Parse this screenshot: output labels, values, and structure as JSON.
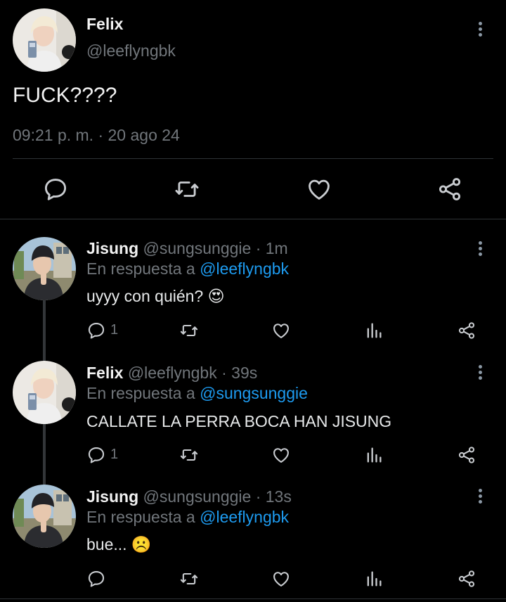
{
  "main_tweet": {
    "name": "Felix",
    "handle": "@leeflyngbk",
    "text": "FUCK????",
    "timestamp": "09:21 p. m. · 20 ago 24"
  },
  "replies": [
    {
      "name": "Jisung",
      "meta": "@sungsunggie · 1m",
      "reply_prefix": "En respuesta a",
      "reply_to": "@leeflyngbk",
      "text": "uyyy con quién? 😍",
      "reply_count": "1"
    },
    {
      "name": "Felix",
      "meta": "@leeflyngbk · 39s",
      "reply_prefix": "En respuesta a",
      "reply_to": "@sungsunggie",
      "text": "CALLATE LA PERRA BOCA HAN JISUNG",
      "reply_count": "1"
    },
    {
      "name": "Jisung",
      "meta": "@sungsunggie · 13s",
      "reply_prefix": "En respuesta a",
      "reply_to": "@leeflyngbk",
      "text": "bue... ☹️",
      "reply_count": ""
    }
  ],
  "colors": {
    "background": "#000000",
    "link": "#1d9bf0",
    "muted": "#71767b"
  }
}
